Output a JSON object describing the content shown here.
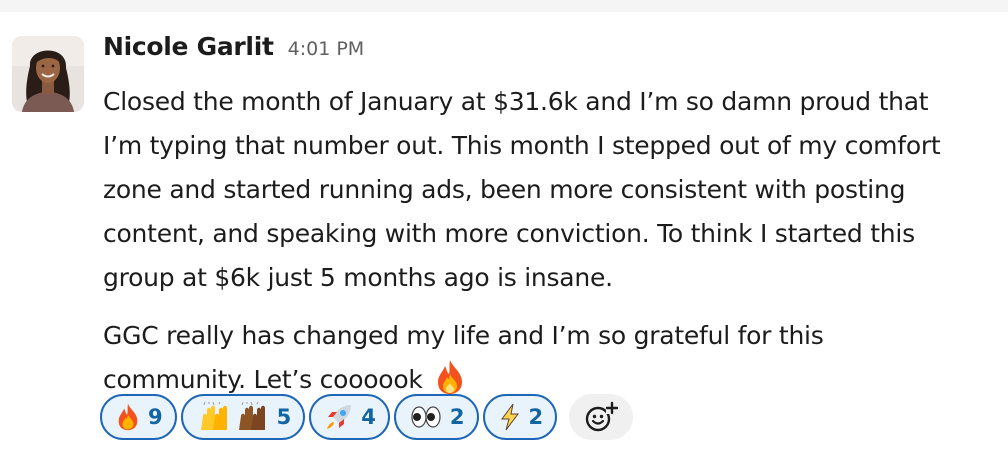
{
  "message": {
    "sender_name": "Nicole Garlit",
    "timestamp": "4:01 PM",
    "paragraphs": [
      {
        "lines": [
          "Closed the month of January at $31.6k and I’m so damn proud that",
          "I’m typing that number out. This month I stepped out of my comfort",
          "zone and started running ads, been more consistent with posting",
          "content, and speaking with more conviction. To think I started this",
          "group at $6k just 5 months ago is insane."
        ]
      },
      {
        "lines": [
          "GGC really has changed my life and I’m so grateful for this",
          "community. Let’s coooook"
        ],
        "trailing_emoji": "fire-emoji"
      }
    ]
  },
  "reactions": [
    {
      "emoji": "fire",
      "count": "9"
    },
    {
      "emoji": "raised-hands",
      "count": "5"
    },
    {
      "emoji": "rocket",
      "count": "4"
    },
    {
      "emoji": "eyes",
      "count": "2"
    },
    {
      "emoji": "zap",
      "count": "2"
    }
  ],
  "add_reaction": {
    "icon": "add-reaction-icon"
  },
  "colors": {
    "reaction_border": "#1d66b8",
    "reaction_background": "#e8f3fc",
    "reaction_count": "#1264a3",
    "timestamp": "#616061",
    "text": "#1d1c1d"
  }
}
